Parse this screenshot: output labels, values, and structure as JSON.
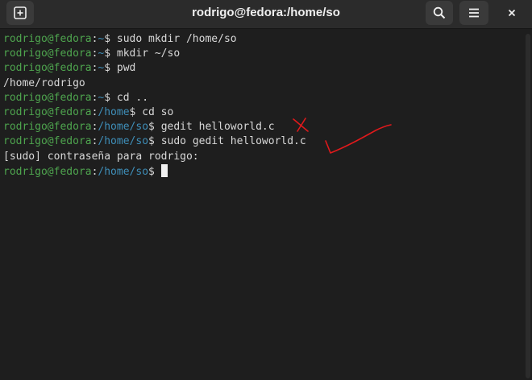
{
  "window": {
    "title": "rodrigo@fedora:/home/so"
  },
  "toolbar": {
    "new_tab_icon": "plus-square-icon",
    "search_icon": "search-icon",
    "menu_icon": "hamburger-menu-icon",
    "close_icon": "close-icon"
  },
  "terminal": {
    "lines": [
      {
        "user": "rodrigo@fedora",
        "path": "~",
        "command": "sudo mkdir /home/so"
      },
      {
        "user": "rodrigo@fedora",
        "path": "~",
        "command": "mkdir ~/so"
      },
      {
        "user": "rodrigo@fedora",
        "path": "~",
        "command": "pwd"
      },
      {
        "output": "/home/rodrigo"
      },
      {
        "user": "rodrigo@fedora",
        "path": "~",
        "command": "cd .."
      },
      {
        "user": "rodrigo@fedora",
        "path": "/home",
        "command": "cd so"
      },
      {
        "user": "rodrigo@fedora",
        "path": "/home/so",
        "command": "gedit helloworld.c"
      },
      {
        "user": "rodrigo@fedora",
        "path": "/home/so",
        "command": "sudo gedit helloworld.c"
      },
      {
        "output": "[sudo] contraseña para rodrigo:"
      },
      {
        "user": "rodrigo@fedora",
        "path": "/home/so",
        "command": ""
      }
    ],
    "prompt_separator": ":",
    "prompt_symbol": "$ "
  },
  "colors": {
    "background": "#1e1e1e",
    "titlebar": "#2b2b2b",
    "prompt_user": "#4ea44e",
    "prompt_path": "#3e8eb8",
    "text": "#d8d8d8",
    "annotation": "#e0191b"
  }
}
